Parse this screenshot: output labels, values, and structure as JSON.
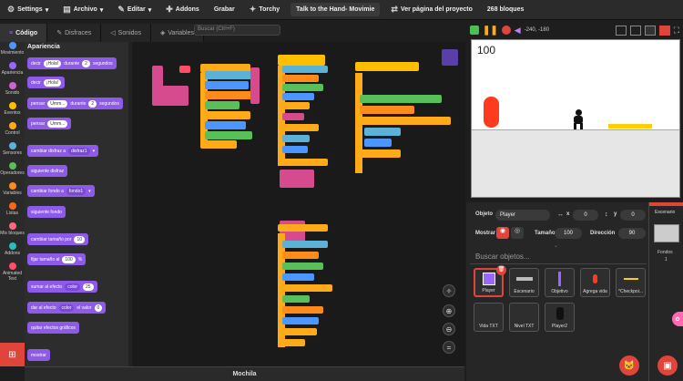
{
  "menu": {
    "settings": "Settings",
    "file": "Archivo",
    "edit": "Editar",
    "addons": "Addons",
    "record": "Grabar",
    "torchy": "Torchy",
    "project_title": "Talk to the Hand- Movimie",
    "see_project": "Ver página del proyecto",
    "blocks_count": "268 bloques"
  },
  "tabs": {
    "code": "Código",
    "costumes": "Disfraces",
    "sounds": "Sonidos",
    "variables": "Variables"
  },
  "workspace": {
    "search_placeholder": "Buscar (Ctrl+F)"
  },
  "categories": [
    {
      "label": "Movimiento",
      "color": "#4c97ff"
    },
    {
      "label": "Apariencia",
      "color": "#9966ff"
    },
    {
      "label": "Sonido",
      "color": "#cf63cf"
    },
    {
      "label": "Eventos",
      "color": "#ffbf00"
    },
    {
      "label": "Control",
      "color": "#ffab19"
    },
    {
      "label": "Sensores",
      "color": "#5cb1d6"
    },
    {
      "label": "Operadores",
      "color": "#59c059"
    },
    {
      "label": "Variables",
      "color": "#ff8c1a"
    },
    {
      "label": "Listas",
      "color": "#ff661a"
    },
    {
      "label": "Mis bloques",
      "color": "#ff6680"
    },
    {
      "label": "Addons",
      "color": "#29beb8"
    },
    {
      "label": "Animated Text",
      "color": "#ff4d6a"
    }
  ],
  "palette": {
    "title": "Apariencia",
    "b1": {
      "say": "decir",
      "hello": "¡Hola!",
      "for": "durante",
      "secs_val": "2",
      "secs": "segundos"
    },
    "b2": {
      "say": "decir",
      "hello": "¡Hola!"
    },
    "b3": {
      "think": "pensar",
      "hmm": "Umm...",
      "for": "durante",
      "secs_val": "2",
      "secs": "segundos"
    },
    "b4": {
      "think": "pensar",
      "hmm": "Umm..."
    },
    "b5": {
      "switch": "cambiar disfraz a",
      "costume": "disfraz1"
    },
    "b6": "siguiente disfraz",
    "b7": {
      "switch": "cambiar fondo a",
      "bg": "fondo1"
    },
    "b8": "siguiente fondo",
    "b9": {
      "change": "cambiar tamaño por",
      "val": "10"
    },
    "b10": {
      "set": "fijar tamaño al",
      "val": "100",
      "pct": "%"
    },
    "b11": {
      "change": "sumar al efecto",
      "effect": "color",
      "val": "25"
    },
    "b12": {
      "set": "dar al efecto",
      "effect": "color",
      "to": "el valor",
      "val": "0"
    },
    "b13": "quitar efectos gráficos",
    "b14": "mostrar"
  },
  "mochila": "Mochila",
  "stage": {
    "coords": "-240, -180",
    "counter": "100"
  },
  "sprite_panel": {
    "sprite_label": "Objeto",
    "sprite_name": "Player",
    "x_label": "x",
    "x_val": "0",
    "y_label": "y",
    "y_val": "0",
    "show_label": "Mostrar",
    "size_label": "Tamaño",
    "size_val": "100",
    "dir_label": "Dirección",
    "dir_val": "90",
    "search_placeholder": "Buscar objetos..."
  },
  "sprites": [
    {
      "name": "Player"
    },
    {
      "name": "Escenario"
    },
    {
      "name": "Objetivo"
    },
    {
      "name": "Agrega vida"
    },
    {
      "name": "*Checkpoi..."
    },
    {
      "name": "Vida TXT"
    },
    {
      "name": "Nivel TXT"
    },
    {
      "name": "Player2"
    }
  ],
  "backdrop_panel": {
    "title": "Escenario",
    "count_label": "Fondos",
    "count": "1"
  }
}
